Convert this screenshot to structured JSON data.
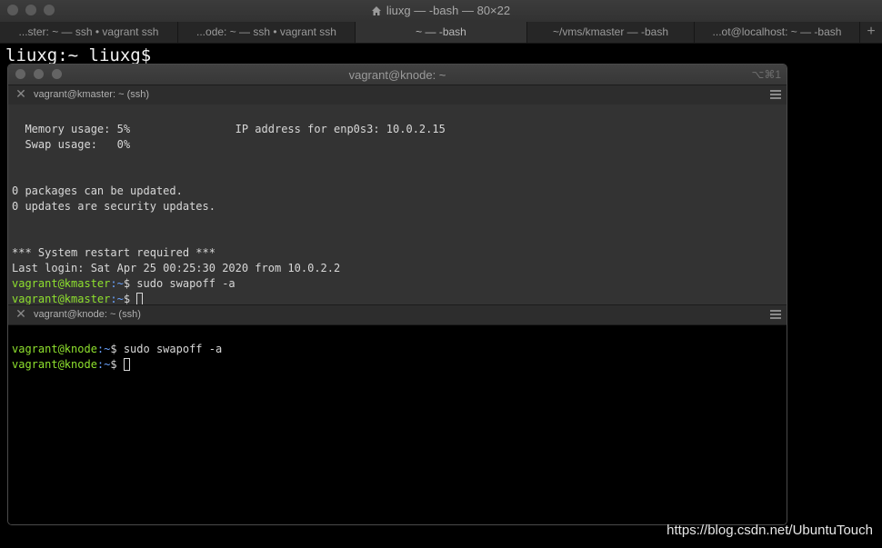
{
  "outer": {
    "title": "liuxg — -bash — 80×22",
    "tabs": [
      "...ster: ~ — ssh • vagrant ssh",
      "...ode: ~ — ssh • vagrant ssh",
      "~ — -bash",
      "~/vms/kmaster — -bash",
      "...ot@localhost: ~ — -bash"
    ],
    "add_tab": "+",
    "prompt": "liuxg:~ liuxg$"
  },
  "inner": {
    "title": "vagrant@knode: ~",
    "shortcut": "⌥⌘1",
    "top_pane": {
      "title": "vagrant@kmaster: ~ (ssh)",
      "lines": [
        "  Memory usage: 5%                IP address for enp0s3: 10.0.2.15",
        "  Swap usage:   0%",
        "",
        "",
        "0 packages can be updated.",
        "0 updates are security updates.",
        "",
        "",
        "*** System restart required ***",
        "Last login: Sat Apr 25 00:25:30 2020 from 10.0.2.2"
      ],
      "prompt_user": "vagrant@kmaster",
      "prompt_path": ":~",
      "prompt_symbol": "$ ",
      "command": "sudo swapoff -a"
    },
    "bottom_pane": {
      "title": "vagrant@knode: ~ (ssh)",
      "prompt_user": "vagrant@knode",
      "prompt_path": ":~",
      "prompt_symbol": "$ ",
      "command": "sudo swapoff -a"
    }
  },
  "watermark": "https://blog.csdn.net/UbuntuTouch"
}
